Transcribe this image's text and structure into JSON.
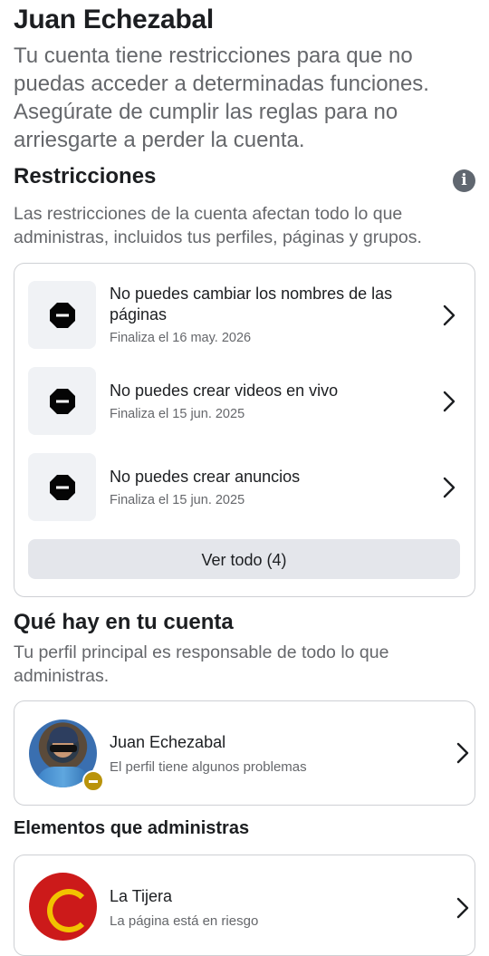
{
  "header": {
    "name": "Juan Echezabal",
    "lead": "Tu cuenta tiene restricciones para que no puedas acceder a determinadas funciones. Asegúrate de cumplir las reglas para no arriesgarte a perder la cuenta."
  },
  "restrictions": {
    "title": "Restricciones",
    "description": "Las restricciones de la cuenta afectan todo lo que administras, incluidos tus perfiles, páginas y grupos.",
    "items": [
      {
        "title": "No puedes cambiar los nombres de las páginas",
        "ends": "Finaliza el 16 may. 2026"
      },
      {
        "title": "No puedes crear videos en vivo",
        "ends": "Finaliza el 15 jun. 2025"
      },
      {
        "title": "No puedes crear anuncios",
        "ends": "Finaliza el 15 jun. 2025"
      }
    ],
    "see_all_label": "Ver todo (4)"
  },
  "account": {
    "title": "Qué hay en tu cuenta",
    "description": "Tu perfil principal es responsable de todo lo que administras.",
    "profile": {
      "name": "Juan Echezabal",
      "status": "El perfil tiene algunos problemas"
    }
  },
  "managed": {
    "title": "Elementos que administras",
    "page": {
      "name": "La Tijera",
      "status": "La página está en riesgo"
    }
  },
  "icons": {
    "info": "info-icon",
    "restriction": "stop-icon",
    "chevron": "chevron-right-icon",
    "warning_badge": "warning-badge-icon"
  },
  "colors": {
    "text": "#1c1e21",
    "secondary": "#65676b",
    "icon_bg": "#f0f2f5",
    "button_bg": "#e4e6eb",
    "warning": "#b9930c"
  }
}
